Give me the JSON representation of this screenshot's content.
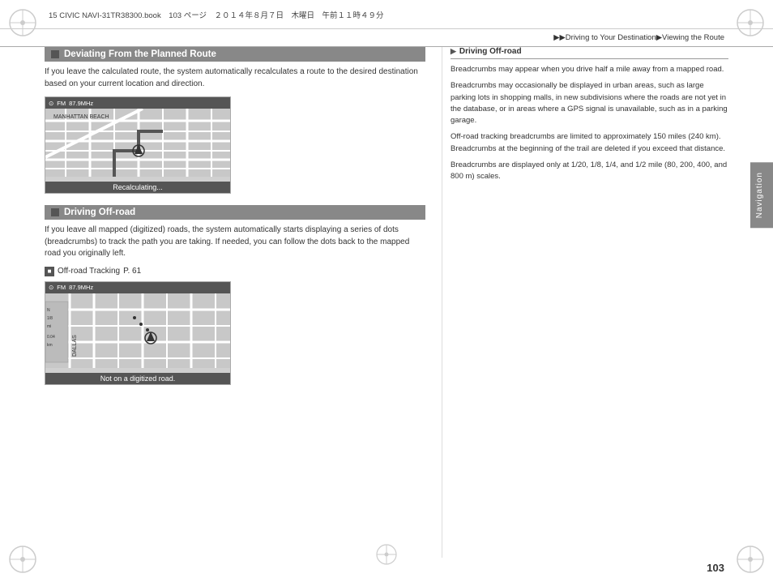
{
  "topbar": {
    "text": "15 CIVIC NAVI-31TR38300.book　103 ページ　２０１４年８月７日　木曜日　午前１１時４９分"
  },
  "breadcrumb": {
    "text": "▶▶Driving to Your Destination▶Viewing the Route"
  },
  "nav_tab": {
    "label": "Navigation"
  },
  "section1": {
    "heading": "Deviating From the Planned Route",
    "body": "If you leave the calculated route, the system automatically recalculates a route to the desired destination based on your current location and direction.",
    "map_label": "Recalculating..."
  },
  "section2": {
    "heading": "Driving Off-road",
    "body": "If you leave all mapped (digitized) roads, the system automatically starts displaying a series of dots (breadcrumbs) to track the path you are taking. If needed, you can follow the dots back to the mapped road you originally left.",
    "crossref_label": "Off-road Tracking",
    "crossref_page": "P. 61",
    "map_label": "Not on a digitized road."
  },
  "right_col": {
    "heading": "Driving Off-road",
    "heading_icon": "▶",
    "para1": "Breadcrumbs may appear when you drive half a mile away from a mapped road.",
    "para2": "Breadcrumbs may occasionally be displayed in urban areas, such as large parking lots in shopping malls, in new subdivisions where the roads are not yet in the database, or in areas where a GPS signal is unavailable, such as in a parking garage.",
    "para3": "Off-road tracking breadcrumbs are limited to approximately 150 miles (240 km). Breadcrumbs at the beginning of the trail are deleted if you exceed that distance.",
    "para4": "Breadcrumbs are displayed only at 1/20, 1/8, 1/4, and 1/2 mile (80, 200, 400, and 800 m) scales."
  },
  "page_number": "103",
  "map1": {
    "fm_label": "FM",
    "freq": "87.9MHz",
    "location_label": "MANHATTAN BEACH"
  },
  "map2": {
    "fm_label": "FM",
    "freq": "87.9MHz",
    "street_label": "DALLAS"
  },
  "icons": {
    "circle_compass": "⊕",
    "crosshair": "⊕"
  }
}
